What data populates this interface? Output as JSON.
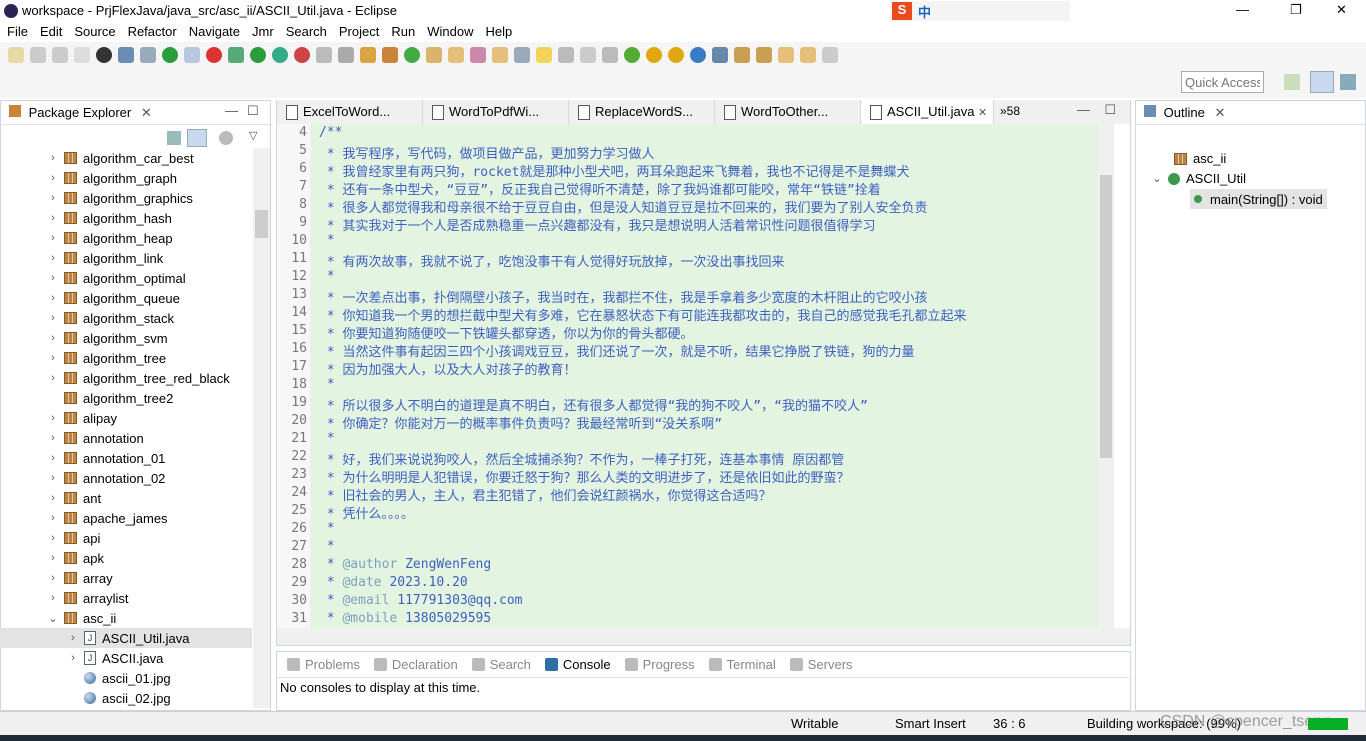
{
  "window": {
    "title": "workspace - PrjFlexJava/java_src/asc_ii/ASCII_Util.java - Eclipse",
    "minimize": "—",
    "maximize": "❐",
    "close": "✕"
  },
  "menu": [
    "File",
    "Edit",
    "Source",
    "Refactor",
    "Navigate",
    "Jmr",
    "Search",
    "Project",
    "Run",
    "Window",
    "Help"
  ],
  "ime": {
    "label": "中"
  },
  "quick_access": {
    "placeholder": "Quick Access"
  },
  "package_explorer": {
    "title": "Package Explorer",
    "items": [
      {
        "label": "algorithm_car_best",
        "type": "pkg",
        "chev": "›"
      },
      {
        "label": "algorithm_graph",
        "type": "pkg",
        "chev": "›"
      },
      {
        "label": "algorithm_graphics",
        "type": "pkg",
        "chev": "›"
      },
      {
        "label": "algorithm_hash",
        "type": "pkg",
        "chev": "›"
      },
      {
        "label": "algorithm_heap",
        "type": "pkg",
        "chev": "›"
      },
      {
        "label": "algorithm_link",
        "type": "pkg",
        "chev": "›"
      },
      {
        "label": "algorithm_optimal",
        "type": "pkg",
        "chev": "›"
      },
      {
        "label": "algorithm_queue",
        "type": "pkg",
        "chev": "›"
      },
      {
        "label": "algorithm_stack",
        "type": "pkg",
        "chev": "›"
      },
      {
        "label": "algorithm_svm",
        "type": "pkg",
        "chev": "›"
      },
      {
        "label": "algorithm_tree",
        "type": "pkg",
        "chev": "›"
      },
      {
        "label": "algorithm_tree_red_black",
        "type": "pkg",
        "chev": "›"
      },
      {
        "label": "algorithm_tree2",
        "type": "pkg",
        "chev": ""
      },
      {
        "label": "alipay",
        "type": "pkg",
        "chev": "›"
      },
      {
        "label": "annotation",
        "type": "pkg",
        "chev": "›"
      },
      {
        "label": "annotation_01",
        "type": "pkg",
        "chev": "›"
      },
      {
        "label": "annotation_02",
        "type": "pkg",
        "chev": "›"
      },
      {
        "label": "ant",
        "type": "pkg",
        "chev": "›"
      },
      {
        "label": "apache_james",
        "type": "pkg",
        "chev": "›"
      },
      {
        "label": "api",
        "type": "pkg",
        "chev": "›"
      },
      {
        "label": "apk",
        "type": "pkg",
        "chev": "›"
      },
      {
        "label": "array",
        "type": "pkg",
        "chev": "›"
      },
      {
        "label": "arraylist",
        "type": "pkg",
        "chev": "›"
      },
      {
        "label": "asc_ii",
        "type": "pkg",
        "chev": "⌄"
      },
      {
        "label": "ASCII_Util.java",
        "type": "java",
        "chev": "›",
        "indent": 1,
        "selected": true
      },
      {
        "label": "ASCII.java",
        "type": "java",
        "chev": "›",
        "indent": 1
      },
      {
        "label": "ascii_01.jpg",
        "type": "img",
        "chev": "",
        "indent": 1
      },
      {
        "label": "ascii_02.jpg",
        "type": "img",
        "chev": "",
        "indent": 1
      }
    ]
  },
  "editor": {
    "tabs": [
      "ExcelToWord...",
      "WordToPdfWi...",
      "ReplaceWordS...",
      "WordToOther...",
      "ASCII_Util.java"
    ],
    "overflow": "»58",
    "lines": [
      {
        "n": "4",
        "t": "/**"
      },
      {
        "n": "5",
        "t": " * 我写程序，写代码，做项目做产品，更加努力学习做人"
      },
      {
        "n": "6",
        "t": " * 我曾经家里有两只狗，rocket就是那种小型犬吧，两耳朵跑起来飞舞着，我也不记得是不是舞蝶犬"
      },
      {
        "n": "7",
        "t": " * 还有一条中型犬，“豆豆”，反正我自己觉得听不清楚，除了我妈谁都可能咬，常年“铁链”拴着"
      },
      {
        "n": "8",
        "t": " * 很多人都觉得我和母亲很不给于豆豆自由，但是没人知道豆豆是拉不回来的，我们要为了别人安全负责"
      },
      {
        "n": "9",
        "t": " * 其实我对于一个人是否成熟稳重一点兴趣都没有，我只是想说明人活着常识性问题很值得学习"
      },
      {
        "n": "10",
        "t": " *"
      },
      {
        "n": "11",
        "t": " * 有两次故事，我就不说了，吃饱没事干有人觉得好玩放掉，一次没出事找回来"
      },
      {
        "n": "12",
        "t": " *"
      },
      {
        "n": "13",
        "t": " * 一次差点出事，扑倒隔壁小孩子，我当时在，我都拦不住，我是手拿着多少宽度的木杆阻止的它咬小孩"
      },
      {
        "n": "14",
        "t": " * 你知道我一个男的想拦截中型犬有多难，它在暴怒状态下有可能连我都攻击的，我自己的感觉我毛孔都立起来"
      },
      {
        "n": "15",
        "t": " * 你要知道狗随便咬一下铁罐头都穿透，你以为你的骨头都硬。"
      },
      {
        "n": "16",
        "t": " * 当然这件事有起因三四个小孩调戏豆豆，我们还说了一次，就是不听，结果它挣脱了铁链，狗的力量"
      },
      {
        "n": "17",
        "t": " * 因为加强大人，以及大人对孩子的教育！"
      },
      {
        "n": "18",
        "t": " *"
      },
      {
        "n": "19",
        "t": " * 所以很多人不明白的道理是真不明白，还有很多人都觉得“我的狗不咬人”，“我的猫不咬人”"
      },
      {
        "n": "20",
        "t": " * 你确定？你能对万一的概率事件负责吗？我最经常听到“没关系啊”"
      },
      {
        "n": "21",
        "t": " *"
      },
      {
        "n": "22",
        "t": " * 好，我们来说说狗咬人，然后全城捕杀狗？不作为，一棒子打死，连基本事情 原因都管"
      },
      {
        "n": "23",
        "t": " * 为什么明明是人犯错误，你要迁怒于狗？那么人类的文明进步了，还是依旧如此的野蛮？"
      },
      {
        "n": "24",
        "t": " * 旧社会的男人，主人，君主犯错了，他们会说红颜祸水，你觉得这合适吗？"
      },
      {
        "n": "25",
        "t": " * 凭什么。。。。"
      },
      {
        "n": "26",
        "t": " *"
      },
      {
        "n": "27",
        "t": " *"
      },
      {
        "n": "28",
        "t": " * ",
        "tag": "@author",
        "v": " ZengWenFeng"
      },
      {
        "n": "29",
        "t": " * ",
        "tag": "@date",
        "v": " 2023.10.20"
      },
      {
        "n": "30",
        "t": " * ",
        "tag": "@email",
        "v": " 117791303@qq.com"
      },
      {
        "n": "31",
        "t": " * ",
        "tag": "@mobile",
        "v": " 13805029595"
      }
    ]
  },
  "bottom": {
    "tabs": [
      "Problems",
      "Declaration",
      "Search",
      "Console",
      "Progress",
      "Terminal",
      "Servers"
    ],
    "active": 3,
    "message": "No consoles to display at this time."
  },
  "outline": {
    "title": "Outline",
    "items": [
      "asc_ii",
      "ASCII_Util",
      "main(String[]) : void"
    ]
  },
  "status": {
    "mode": "Writable",
    "insert": "Smart Insert",
    "position": "36 : 6",
    "building": "Building workspace: (99%)",
    "progress": 0.99,
    "watermark": "CSDN @spencer_tseng"
  }
}
